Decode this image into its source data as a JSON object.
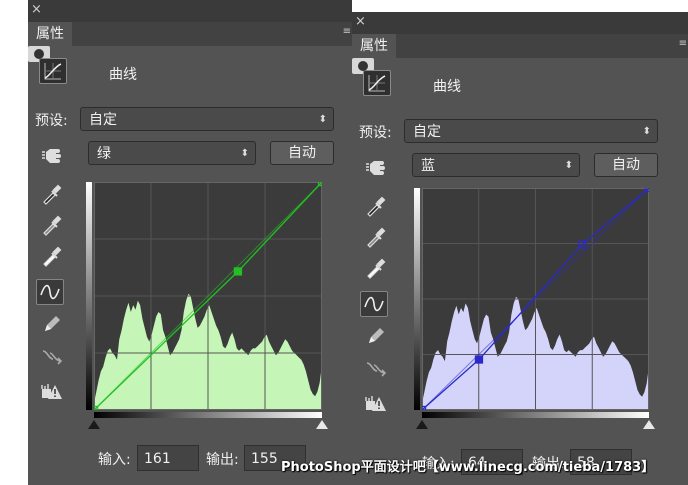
{
  "watermark": "PhotoShop平面设计吧【www.linecg.com/tieba/1783】",
  "colors": {
    "panel_bg": "#535353",
    "graph_bg": "#3b3b3b",
    "green": "#22c022",
    "blue": "#2a2acc"
  },
  "panels": [
    {
      "close_label": "×",
      "tab_label": "属性",
      "menu_label": "≡",
      "mode_label": "曲线",
      "preset_label": "预设:",
      "preset_value": "自定",
      "channel_value": "绿",
      "auto_label": "自动",
      "input_label": "输入:",
      "input_value": "161",
      "output_label": "输出:",
      "output_value": "155",
      "curve_color": "#22c022",
      "histogram_fill": "#c6f5b8",
      "points": [
        {
          "in": 0,
          "out": 0
        },
        {
          "in": 161,
          "out": 155
        },
        {
          "in": 255,
          "out": 255
        }
      ],
      "selected_point": 1
    },
    {
      "close_label": "×",
      "tab_label": "属性",
      "menu_label": "≡",
      "mode_label": "曲线",
      "preset_label": "预设:",
      "preset_value": "自定",
      "channel_value": "蓝",
      "auto_label": "自动",
      "input_label": "输入:",
      "input_value": "64",
      "output_label": "输出:",
      "output_value": "58",
      "curve_color": "#2a2acc",
      "histogram_fill": "#d4d4fa",
      "points": [
        {
          "in": 0,
          "out": 0
        },
        {
          "in": 64,
          "out": 58
        },
        {
          "in": 180,
          "out": 190
        },
        {
          "in": 255,
          "out": 255
        }
      ],
      "selected_point": 1
    }
  ],
  "histogram": [
    0.03,
    0.08,
    0.13,
    0.17,
    0.19,
    0.23,
    0.26,
    0.27,
    0.25,
    0.24,
    0.22,
    0.31,
    0.35,
    0.4,
    0.44,
    0.47,
    0.43,
    0.46,
    0.44,
    0.48,
    0.46,
    0.4,
    0.36,
    0.32,
    0.3,
    0.33,
    0.37,
    0.41,
    0.43,
    0.42,
    0.35,
    0.32,
    0.28,
    0.24,
    0.25,
    0.27,
    0.29,
    0.31,
    0.35,
    0.43,
    0.48,
    0.51,
    0.5,
    0.45,
    0.4,
    0.36,
    0.37,
    0.39,
    0.41,
    0.44,
    0.46,
    0.43,
    0.4,
    0.37,
    0.35,
    0.32,
    0.28,
    0.27,
    0.29,
    0.32,
    0.34,
    0.31,
    0.27,
    0.26,
    0.27,
    0.26,
    0.25,
    0.24,
    0.26,
    0.27,
    0.27,
    0.28,
    0.29,
    0.3,
    0.32,
    0.33,
    0.3,
    0.28,
    0.26,
    0.24,
    0.25,
    0.27,
    0.29,
    0.31,
    0.3,
    0.28,
    0.26,
    0.25,
    0.24,
    0.23,
    0.22,
    0.2,
    0.17,
    0.13,
    0.09,
    0.07,
    0.06,
    0.08,
    0.12,
    0.2
  ]
}
